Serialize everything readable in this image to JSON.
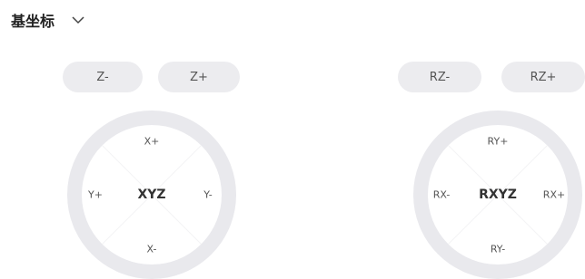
{
  "header": {
    "title": "基坐标",
    "dropdown_icon": "chevron-down-icon"
  },
  "linear": {
    "z_minus": "Z-",
    "z_plus": "Z+",
    "pad": {
      "up": "X+",
      "down": "X-",
      "left": "Y+",
      "right": "Y-",
      "center": "XYZ"
    }
  },
  "rotary": {
    "z_minus": "RZ-",
    "z_plus": "RZ+",
    "pad": {
      "up": "RY+",
      "down": "RY-",
      "left": "RX-",
      "right": "RX+",
      "center": "RXYZ"
    }
  },
  "colors": {
    "button_bg": "#ececef",
    "ring": "#e9e9ed"
  }
}
